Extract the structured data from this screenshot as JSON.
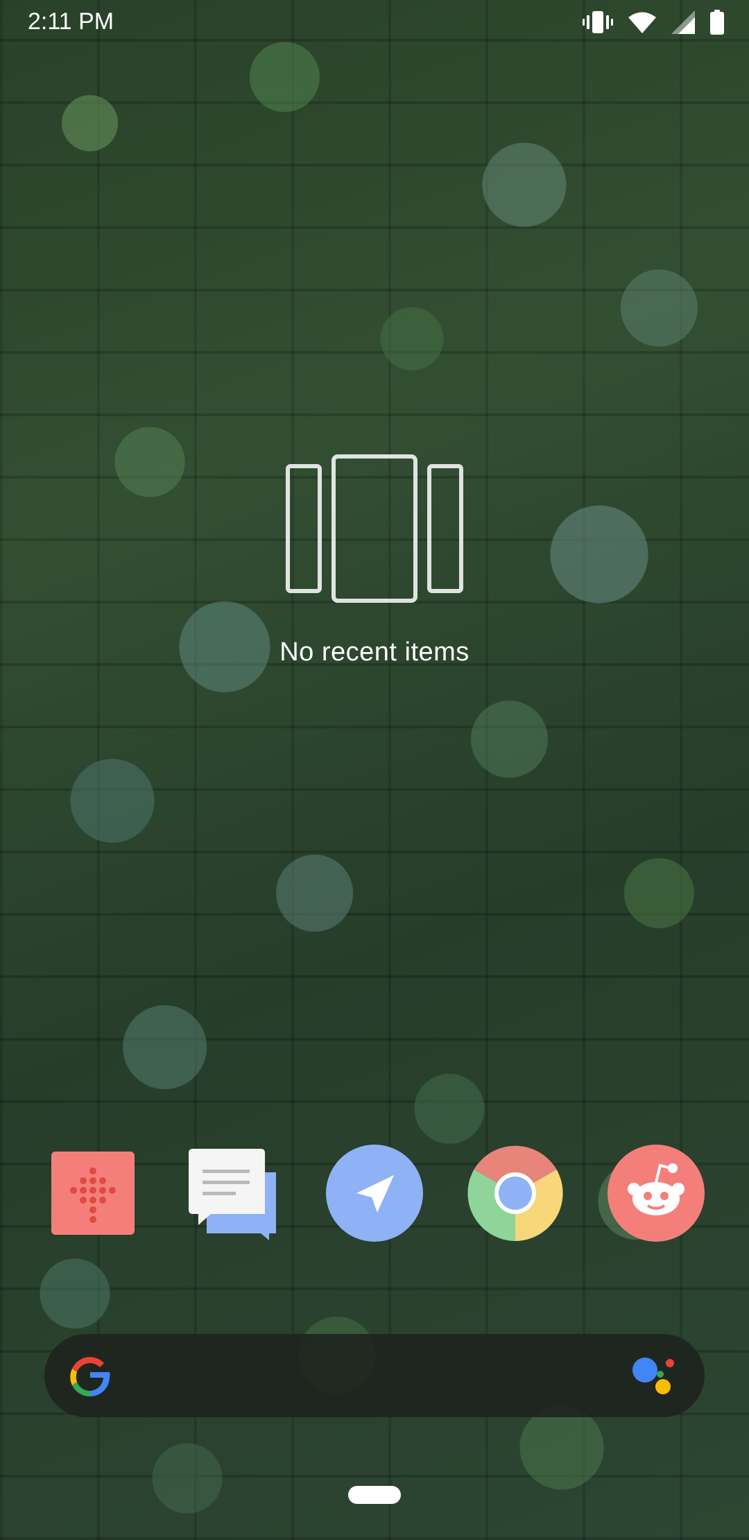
{
  "status_bar": {
    "time": "2:11 PM",
    "icons": [
      "vibrate-icon",
      "wifi-icon",
      "cell-signal-icon",
      "battery-icon"
    ]
  },
  "recents": {
    "empty_icon": "recents-cards-icon",
    "empty_message": "No recent items"
  },
  "dock": {
    "apps": [
      {
        "name": "Phone",
        "icon": "phone-dialpad-icon",
        "color": "#f47f7a"
      },
      {
        "name": "Messages",
        "icon": "messages-icon",
        "color": "#8fb2f6"
      },
      {
        "name": "Send",
        "icon": "send-arrow-icon",
        "color": "#8fb2f6"
      },
      {
        "name": "Chrome",
        "icon": "chrome-icon",
        "color": "#e7857b"
      },
      {
        "name": "Reddit",
        "icon": "reddit-icon",
        "color": "#f47f7a"
      }
    ]
  },
  "search_bar": {
    "left_icon": "google-g-icon",
    "right_icon": "google-assistant-icon"
  },
  "colors": {
    "status_text": "#ffffff",
    "search_bar_bg": "#1e221e"
  }
}
